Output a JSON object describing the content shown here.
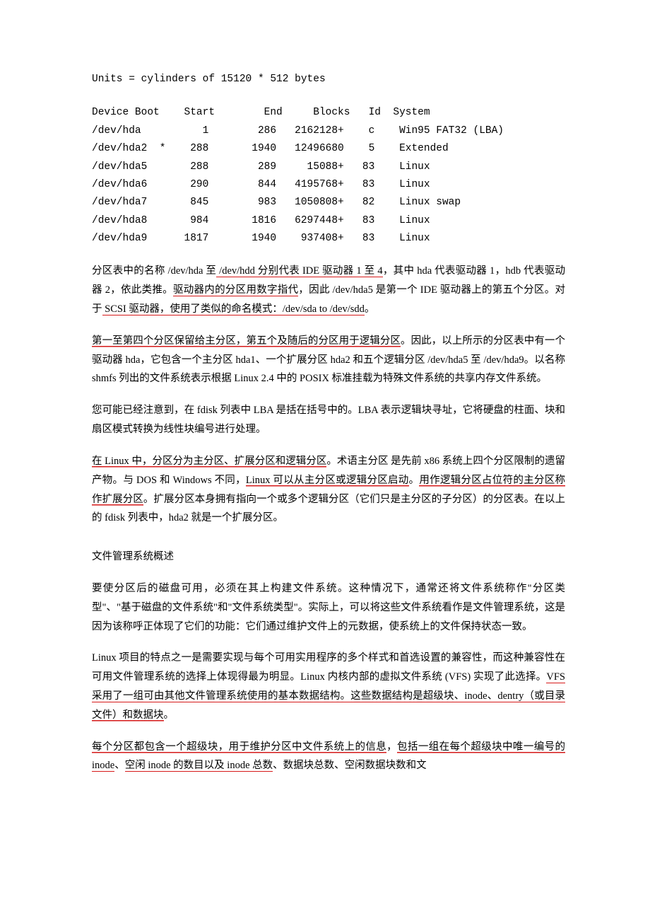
{
  "units_line": "Units = cylinders of 15120 * 512 bytes",
  "table": {
    "header": [
      "Device Boot",
      "Start",
      "End",
      "Blocks",
      "Id",
      "System"
    ],
    "rows": [
      {
        "device": "/dev/hda",
        "boot": "",
        "start": "1",
        "end": "286",
        "blocks": "2162128+",
        "id": "c",
        "system": "Win95 FAT32 (LBA)"
      },
      {
        "device": "/dev/hda2",
        "boot": "*",
        "start": "288",
        "end": "1940",
        "blocks": "12496680",
        "id": "5",
        "system": "Extended"
      },
      {
        "device": "/dev/hda5",
        "boot": "",
        "start": "288",
        "end": "289",
        "blocks": "15088+",
        "id": "83",
        "system": "Linux"
      },
      {
        "device": "/dev/hda6",
        "boot": "",
        "start": "290",
        "end": "844",
        "blocks": "4195768+",
        "id": "83",
        "system": "Linux"
      },
      {
        "device": "/dev/hda7",
        "boot": "",
        "start": "845",
        "end": "983",
        "blocks": "1050808+",
        "id": "82",
        "system": "Linux swap"
      },
      {
        "device": "/dev/hda8",
        "boot": "",
        "start": "984",
        "end": "1816",
        "blocks": "6297448+",
        "id": "83",
        "system": "Linux"
      },
      {
        "device": "/dev/hda9",
        "boot": "",
        "start": "1817",
        "end": "1940",
        "blocks": "937408+",
        "id": "83",
        "system": "Linux"
      }
    ]
  },
  "p1": {
    "t0": "分区表中的名称 /dev/hda 至",
    "u1": " /dev/hdd 分别代表 IDE 驱动器 1 至 4",
    "t2": "，其中 hda 代表驱动器 1，hdb 代表驱动器 2，依此类推。",
    "u3": "驱动器内的分区用数字指代",
    "t4": "，因此 /dev/hda5 是第一个 IDE 驱动器上的第五个分区。对于",
    "u5": " SCSI 驱动器，使用了类似的命名模式：/dev/sda to /dev/sdd",
    "t6": "。"
  },
  "p2": {
    "u1": "第一至第四个分区保留给主分区，第五个及随后的分区用于逻辑分区",
    "t2": "。因此，以上所示的分区表中有一个驱动器 hda，它包含一个主分区 hda1、一个扩展分区 hda2 和五个逻辑分区 /dev/hda5 至 /dev/hda9。以名称 shmfs 列出的文件系统表示根据 Linux 2.4 中的 POSIX 标准挂载为特殊文件系统的共享内存文件系统。"
  },
  "p3": "您可能已经注意到，在 fdisk 列表中 LBA 是括在括号中的。LBA 表示逻辑块寻址，它将硬盘的柱面、块和扇区模式转换为线性块编号进行处理。",
  "p4": {
    "u1": "在 Linux 中，分区分为主分区、扩展分区和逻辑分区",
    "t2": "。术语主分区 是先前 x86 系统上四个分区限制的遗留产物。与 DOS 和 Windows 不同，",
    "u3": "Linux 可以从主分区或逻辑分区启动",
    "t4": "。",
    "u5": "用作逻辑分区占位符的主分区称作扩展分区",
    "t6": "。扩展分区本身拥有指向一个或多个逻辑分区（它们只是主分区的子分区）的分区表。在以上的 fdisk 列表中，hda2 就是一个扩展分区。"
  },
  "h2": "文件管理系统概述",
  "p5": "要使分区后的磁盘可用，必须在其上构建文件系统。这种情况下，通常还将文件系统称作\"分区类型\"、\"基于磁盘的文件系统\"和\"文件系统类型\"。实际上，可以将这些文件系统看作是文件管理系统，这是因为该称呼正体现了它们的功能：它们通过维护文件上的元数据，使系统上的文件保持状态一致。",
  "p6": {
    "t1": "Linux 项目的特点之一是需要实现与每个可用实用程序的多个样式和首选设置的兼容性，而这种兼容性在可用文件管理系统的选择上体现得最为明显。Linux 内核内部的虚拟文件系统 (VFS) 实现了此选择。",
    "u2": "VFS 采用了一组可由其他文件管理系统使用的基本数据结构。这些数据结构是超级块、inode、dentry（或目录文件）和数据块",
    "t3": "。"
  },
  "p7": {
    "u1": "每个分区都包含一个超级块，用于维护分区中文件系统上的信息",
    "t2": "，",
    "u3": "包括一组在每个超级块中唯一编号的 inode",
    "t4": "、",
    "u5": "空闲 inode 的数目以及 inode 总数",
    "t6": "、数据块总数、空闲数据块数和文"
  }
}
